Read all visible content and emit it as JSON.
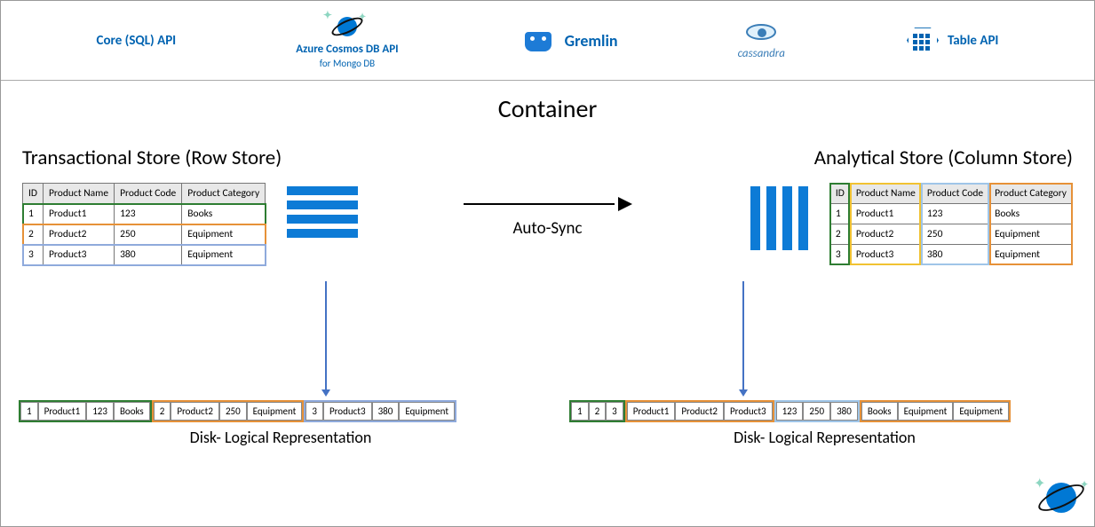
{
  "apis": {
    "core": "Core (SQL) API",
    "mongo_line1": "Azure Cosmos DB API",
    "mongo_line2": "for Mongo DB",
    "gremlin": "Gremlin",
    "cassandra": "cassandra",
    "table": "Table API"
  },
  "container_title": "Container",
  "left_store_title": "Transactional Store (Row Store)",
  "right_store_title": "Analytical Store (Column Store)",
  "sync_label": "Auto-Sync",
  "headers": {
    "id": "ID",
    "name": "Product Name",
    "code": "Product Code",
    "cat": "Product Category"
  },
  "rows": [
    {
      "id": "1",
      "name": "Product1",
      "code": "123",
      "cat": "Books"
    },
    {
      "id": "2",
      "name": "Product2",
      "code": "250",
      "cat": "Equipment"
    },
    {
      "id": "3",
      "name": "Product3",
      "code": "380",
      "cat": "Equipment"
    }
  ],
  "disk_label": "Disk- Logical Representation",
  "colors": {
    "green": "#2e7d32",
    "orange": "#e69138",
    "blue": "#8faadc",
    "yellow": "#f1c232",
    "lightblue": "#9fc5e8"
  }
}
